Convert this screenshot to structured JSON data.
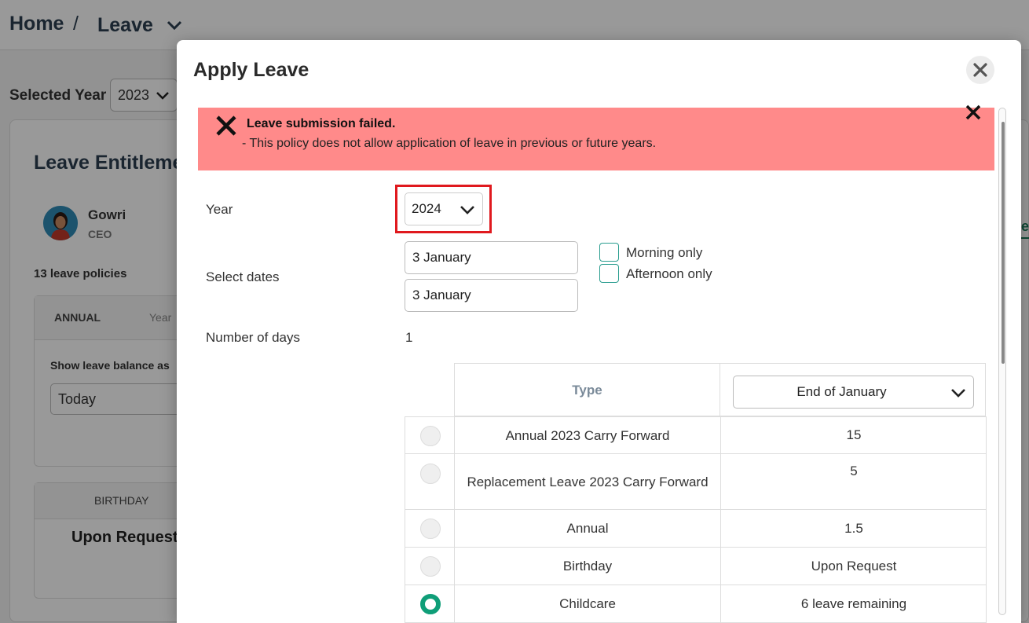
{
  "background": {
    "breadcrumb": {
      "home": "Home",
      "separator": "/",
      "current": "Leave"
    },
    "selected_year": {
      "label": "Selected Year",
      "value": "2023"
    },
    "entitlement_title": "Leave Entitleme",
    "person": {
      "name": "Gowri",
      "role": "CEO"
    },
    "policies_count": "13 leave policies",
    "annual_card": {
      "title": "ANNUAL",
      "year_col": "Year",
      "show_balance": "Show leave balance as",
      "balance_value": "Today"
    },
    "birthday_card": {
      "title": "BIRTHDAY",
      "value": "Upon Request"
    },
    "right_fragment": "e"
  },
  "modal": {
    "title": "Apply Leave",
    "alert": {
      "title": "Leave submission failed.",
      "message": "- This policy does not allow application of leave in previous or future years."
    },
    "year": {
      "label": "Year",
      "value": "2024"
    },
    "dates": {
      "label": "Select dates",
      "start": "3 January",
      "end": "3 January"
    },
    "half_day": {
      "morning": "Morning only",
      "afternoon": "Afternoon only"
    },
    "days": {
      "label": "Number of days",
      "value": "1"
    },
    "table": {
      "type_header": "Type",
      "balance_selector": "End of January",
      "rows": [
        {
          "type": "Annual 2023 Carry Forward",
          "balance": "15",
          "selected": false
        },
        {
          "type": "Replacement Leave 2023 Carry Forward",
          "balance": "5",
          "selected": false
        },
        {
          "type": "Annual",
          "balance": "1.5",
          "selected": false
        },
        {
          "type": "Birthday",
          "balance": "Upon Request",
          "selected": false
        },
        {
          "type": "Childcare",
          "balance": "6 leave remaining",
          "selected": true
        }
      ]
    }
  },
  "colors": {
    "alert_bg": "#ff8a8a",
    "highlight": "#e0191e",
    "accent": "#0f9e78",
    "checkbox_border": "#2a9d8f"
  },
  "icons": {
    "close": "close-icon",
    "error": "error-x-icon",
    "dropdown": "chevron-down-icon"
  }
}
